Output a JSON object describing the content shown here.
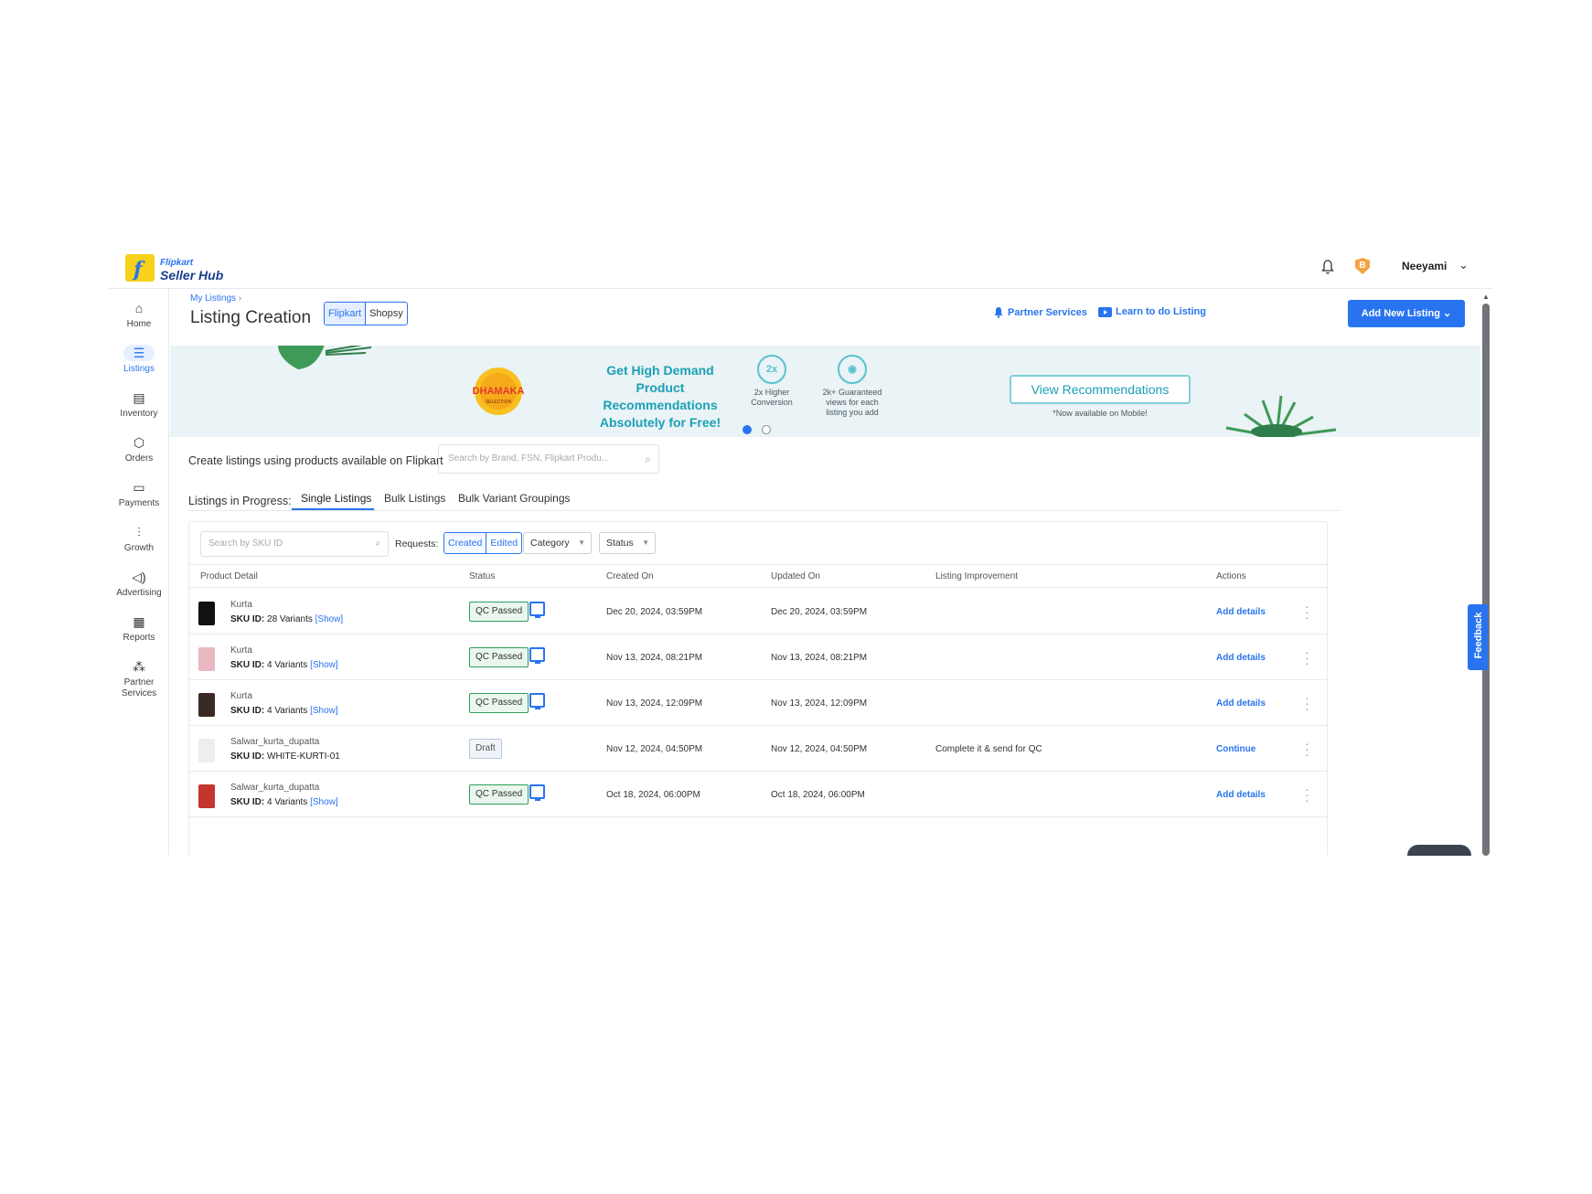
{
  "header": {
    "logo_small": "Flipkart",
    "logo_big": "Seller Hub",
    "badge_letter": "B",
    "user_name": "Neeyami"
  },
  "sidebar": {
    "items": [
      {
        "label": "Home",
        "icon": "home-icon"
      },
      {
        "label": "Listings",
        "icon": "list-icon"
      },
      {
        "label": "Inventory",
        "icon": "inventory-icon"
      },
      {
        "label": "Orders",
        "icon": "box-icon"
      },
      {
        "label": "Payments",
        "icon": "card-icon"
      },
      {
        "label": "Growth",
        "icon": "growth-icon"
      },
      {
        "label": "Advertising",
        "icon": "megaphone-icon"
      },
      {
        "label": "Reports",
        "icon": "clipboard-icon"
      },
      {
        "label": "Partner",
        "label2": "Services",
        "icon": "people-icon"
      }
    ]
  },
  "page": {
    "breadcrumb": "My Listings",
    "title": "Listing Creation",
    "toggle": [
      "Flipkart",
      "Shopsy"
    ],
    "partner_services": "Partner Services",
    "learn": "Learn to do Listing",
    "add_new": "Add New Listing"
  },
  "banner": {
    "dhamaka": "DHAMAKA",
    "dhamaka_sub": "SELECTION",
    "headline": [
      "Get High Demand Product",
      "Recommendations",
      "Absolutely for Free!"
    ],
    "feature1_icon": "2x",
    "feature1": [
      "2x Higher",
      "Conversion"
    ],
    "feature2": [
      "2k+ Guaranteed",
      "views for each",
      "listing you add"
    ],
    "cta": "View Recommendations",
    "note": "*Now available on Mobile!"
  },
  "create": {
    "label": "Create listings using products available on Flipkart",
    "placeholder": "Search by Brand, FSN, Flipkart Produ..."
  },
  "tabs": {
    "label": "Listings in Progress:",
    "items": [
      "Single Listings",
      "Bulk Listings",
      "Bulk Variant Groupings"
    ],
    "active": "Single Listings"
  },
  "filters": {
    "sku_placeholder": "Search by SKU ID",
    "requests_label": "Requests:",
    "requests": [
      "Created",
      "Edited"
    ],
    "category": "Category",
    "status": "Status"
  },
  "table": {
    "columns": [
      "Product Detail",
      "Status",
      "Created On",
      "Updated On",
      "Listing Improvement",
      "Actions"
    ],
    "sku_prefix": "SKU ID:",
    "rows": [
      {
        "name": "Kurta",
        "sku": "28 Variants",
        "show": "[Show]",
        "status": "QC Passed",
        "created": "Dec 20, 2024, 03:59PM",
        "updated": "Dec 20, 2024, 03:59PM",
        "improvement": "",
        "action": "Add details",
        "thumb": "#111111"
      },
      {
        "name": "Kurta",
        "sku": "4 Variants",
        "show": "[Show]",
        "status": "QC Passed",
        "created": "Nov 13, 2024, 08:21PM",
        "updated": "Nov 13, 2024, 08:21PM",
        "improvement": "",
        "action": "Add details",
        "thumb": "#e9b8c2"
      },
      {
        "name": "Kurta",
        "sku": "4 Variants",
        "show": "[Show]",
        "status": "QC Passed",
        "created": "Nov 13, 2024, 12:09PM",
        "updated": "Nov 13, 2024, 12:09PM",
        "improvement": "",
        "action": "Add details",
        "thumb": "#3a2a25"
      },
      {
        "name": "Salwar_kurta_dupatta",
        "sku": "WHITE-KURTI-01",
        "show": "",
        "status": "Draft",
        "created": "Nov 12, 2024, 04:50PM",
        "updated": "Nov 12, 2024, 04:50PM",
        "improvement": "Complete it & send for QC",
        "action": "Continue",
        "thumb": "#eeeeee"
      },
      {
        "name": "Salwar_kurta_dupatta",
        "sku": "4 Variants",
        "show": "[Show]",
        "status": "QC Passed",
        "created": "Oct 18, 2024, 06:00PM",
        "updated": "Oct 18, 2024, 06:00PM",
        "improvement": "",
        "action": "Add details",
        "thumb": "#c4352d"
      }
    ]
  },
  "feedback": "Feedback",
  "colors": {
    "accent": "#2874f0",
    "banner_bg": "#eaf3f5",
    "teal": "#1aa0b7",
    "qc_green": "#2e9d5a"
  }
}
